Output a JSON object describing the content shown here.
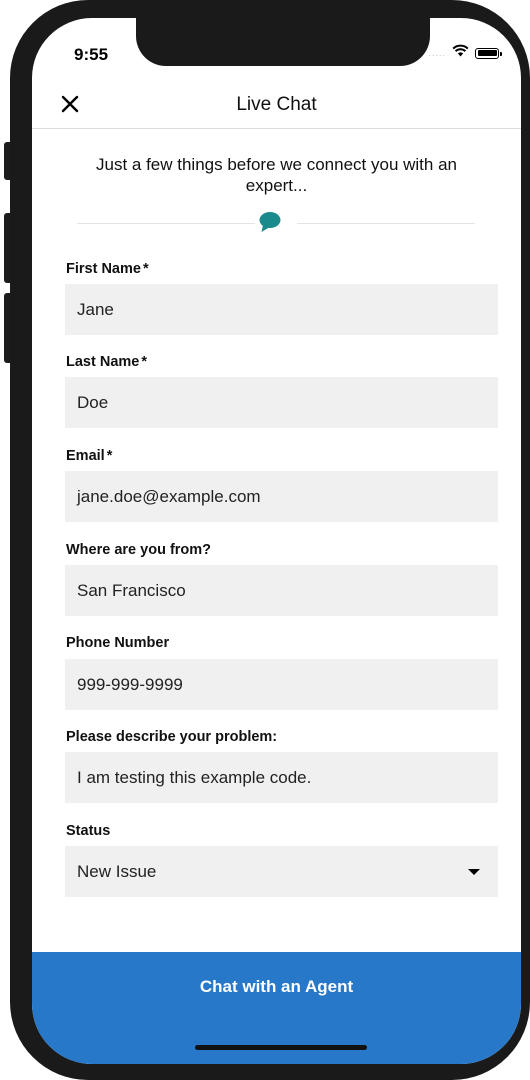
{
  "status_bar": {
    "time": "9:55",
    "signal_dots": "....."
  },
  "nav": {
    "title": "Live Chat",
    "close_icon": "close-icon"
  },
  "intro": {
    "text": "Just a few things before we connect you with an expert...",
    "icon": "chat-bubble-icon",
    "accent": "#1b8a8c"
  },
  "form": {
    "required_mark": "*",
    "fields": [
      {
        "label": "First Name",
        "required": true,
        "value": "Jane"
      },
      {
        "label": "Last Name",
        "required": true,
        "value": "Doe"
      },
      {
        "label": "Email",
        "required": true,
        "value": "jane.doe@example.com"
      },
      {
        "label": "Where are you from?",
        "required": false,
        "value": "San Francisco"
      },
      {
        "label": "Phone Number",
        "required": false,
        "value": "999-999-9999"
      },
      {
        "label": "Please describe your problem:",
        "required": false,
        "value": "I am testing this example code."
      },
      {
        "label": "Status",
        "required": false,
        "value": "New Issue",
        "type": "select"
      }
    ]
  },
  "cta": {
    "label": "Chat with an Agent",
    "color": "#2778c9"
  }
}
